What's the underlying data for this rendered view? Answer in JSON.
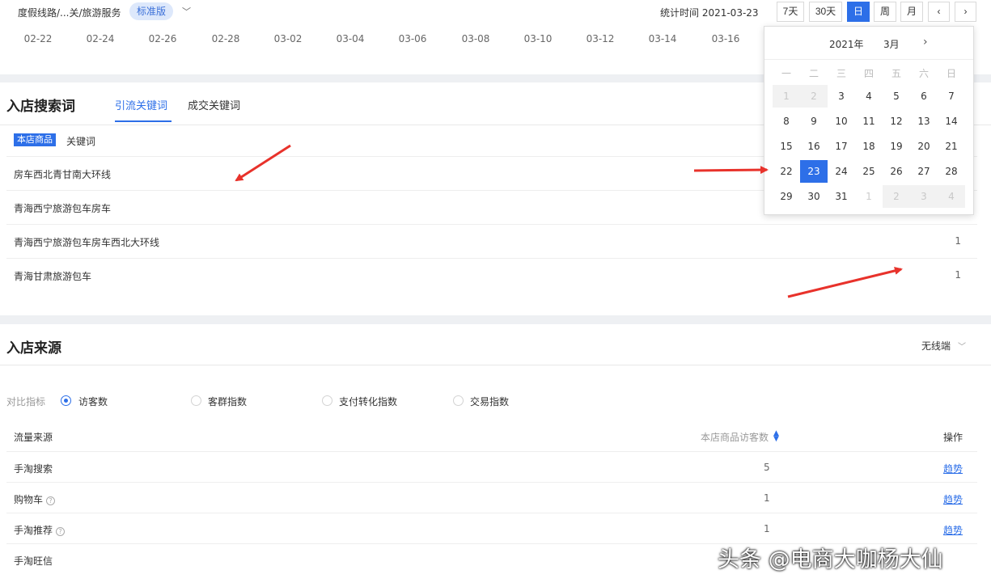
{
  "topbar": {
    "breadcrumb": "度假线路/...关/旅游服务",
    "edition_badge": "标准版",
    "stat_time": "统计时间 2021-03-23",
    "range_buttons": [
      "7天",
      "30天",
      "日",
      "周",
      "月"
    ],
    "active_range": "日",
    "prev": "‹",
    "next": "›"
  },
  "axis_dates": [
    "02-22",
    "02-24",
    "02-26",
    "02-28",
    "03-02",
    "03-04",
    "03-06",
    "03-08",
    "03-10",
    "03-12",
    "03-14",
    "03-16"
  ],
  "search_words": {
    "title": "入店搜索词",
    "tabs": [
      "引流关键词",
      "成交关键词"
    ],
    "active_tab": "引流关键词",
    "tag": "本店商品",
    "column": "关键词",
    "rows": [
      {
        "keyword": "房车西北青甘南大环线",
        "value": ""
      },
      {
        "keyword": "青海西宁旅游包车房车",
        "value": ""
      },
      {
        "keyword": "青海西宁旅游包车房车西北大环线",
        "value": "1"
      },
      {
        "keyword": "青海甘肃旅游包车",
        "value": "1"
      }
    ]
  },
  "sources": {
    "title": "入店来源",
    "device": "无线端",
    "compare_label": "对比指标",
    "metrics": [
      "访客数",
      "客群指数",
      "支付转化指数",
      "交易指数"
    ],
    "selected_metric": "访客数",
    "columns": {
      "source": "流量来源",
      "visitors": "本店商品访客数",
      "action": "操作"
    },
    "rows": [
      {
        "name": "手淘搜索",
        "help": false,
        "value": "5",
        "action": "趋势"
      },
      {
        "name": "购物车",
        "help": true,
        "value": "1",
        "action": "趋势"
      },
      {
        "name": "手淘推荐",
        "help": true,
        "value": "1",
        "action": "趋势"
      },
      {
        "name": "手淘旺信",
        "help": false,
        "value": "",
        "action": ""
      }
    ]
  },
  "calendar": {
    "year": "2021年",
    "month": "3月",
    "weekdays": [
      "一",
      "二",
      "三",
      "四",
      "五",
      "六",
      "日"
    ],
    "weeks": [
      [
        "1",
        "2",
        "3",
        "4",
        "5",
        "6",
        "7"
      ],
      [
        "8",
        "9",
        "10",
        "11",
        "12",
        "13",
        "14"
      ],
      [
        "15",
        "16",
        "17",
        "18",
        "19",
        "20",
        "21"
      ],
      [
        "22",
        "23",
        "24",
        "25",
        "26",
        "27",
        "28"
      ],
      [
        "29",
        "30",
        "31",
        "1",
        "2",
        "3",
        "4"
      ]
    ],
    "selected": "23"
  },
  "watermark": "头条 @电商大咖杨大仙",
  "colors": {
    "accent": "#2d6fe8",
    "arrow": "#e8322b"
  }
}
